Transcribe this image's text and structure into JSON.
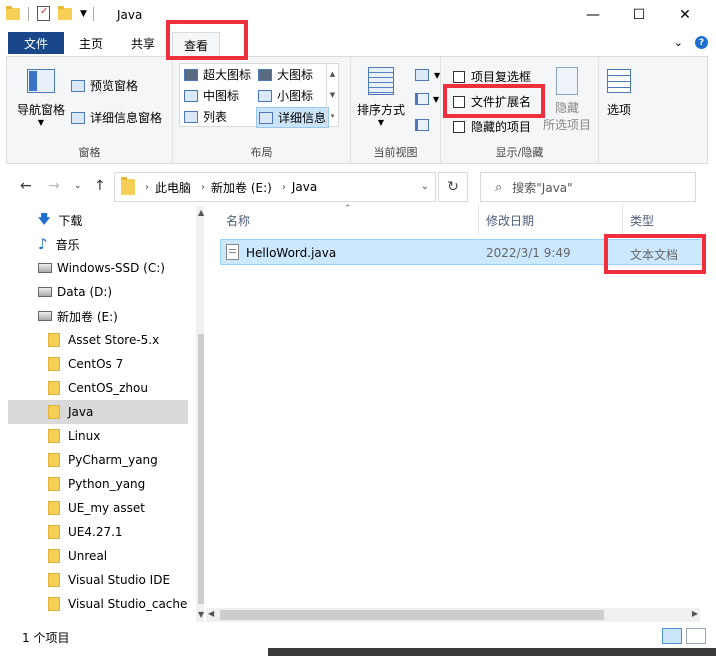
{
  "window": {
    "title": "Java",
    "minimize_glyph": "—",
    "maximize_glyph": "☐",
    "close_glyph": "✕"
  },
  "tabs": {
    "file": "文件",
    "home": "主页",
    "share": "共享",
    "view": "查看",
    "collapse_glyph": "⌄"
  },
  "ribbon": {
    "pane_group": {
      "label": "窗格",
      "nav_pane": "导航窗格",
      "preview_pane": "预览窗格",
      "details_pane": "详细信息窗格"
    },
    "layout_group": {
      "label": "布局",
      "extra_large": "超大图标",
      "large": "大图标",
      "medium": "中图标",
      "small": "小图标",
      "list": "列表",
      "details": "详细信息"
    },
    "current_view_group": {
      "label": "当前视图",
      "sort_by": "排序方式"
    },
    "show_hide_group": {
      "label": "显示/隐藏",
      "item_checkboxes": "项目复选框",
      "file_extensions": "文件扩展名",
      "hidden_items": "隐藏的项目",
      "hide": "隐藏",
      "hide_selected": "所选项目"
    },
    "options": "选项"
  },
  "address": {
    "crumbs": [
      "此电脑",
      "新加卷 (E:)",
      "Java"
    ],
    "search_placeholder": "搜索\"Java\""
  },
  "nav_pane": {
    "items": [
      {
        "label": "下载",
        "icon": "download-icon"
      },
      {
        "label": "音乐",
        "icon": "music-icon"
      },
      {
        "label": "Windows-SSD (C:)",
        "icon": "drive-icon"
      },
      {
        "label": "Data (D:)",
        "icon": "drive-icon"
      },
      {
        "label": "新加卷 (E:)",
        "icon": "drive-icon"
      },
      {
        "label": "Asset Store-5.x",
        "icon": "folder-icon"
      },
      {
        "label": "CentOs 7",
        "icon": "folder-icon"
      },
      {
        "label": "CentOS_zhou",
        "icon": "folder-icon"
      },
      {
        "label": "Java",
        "icon": "folder-icon",
        "selected": true
      },
      {
        "label": "Linux",
        "icon": "folder-icon"
      },
      {
        "label": "PyCharm_yang",
        "icon": "folder-icon"
      },
      {
        "label": "Python_yang",
        "icon": "folder-icon"
      },
      {
        "label": "UE_my asset",
        "icon": "folder-icon"
      },
      {
        "label": "UE4.27.1",
        "icon": "folder-icon"
      },
      {
        "label": "Unreal",
        "icon": "folder-icon"
      },
      {
        "label": "Visual Studio IDE",
        "icon": "folder-icon"
      },
      {
        "label": "Visual Studio_cache",
        "icon": "folder-icon"
      }
    ]
  },
  "file_list": {
    "columns": {
      "name": "名称",
      "modified": "修改日期",
      "type": "类型"
    },
    "rows": [
      {
        "name": "HelloWord.java",
        "modified": "2022/3/1 9:49",
        "type": "文本文档"
      }
    ]
  },
  "status": {
    "count": "1 个项目"
  },
  "colors": {
    "file_tab": "#19478a",
    "highlight": "#ef2f3b",
    "selection": "#cce8ff"
  }
}
